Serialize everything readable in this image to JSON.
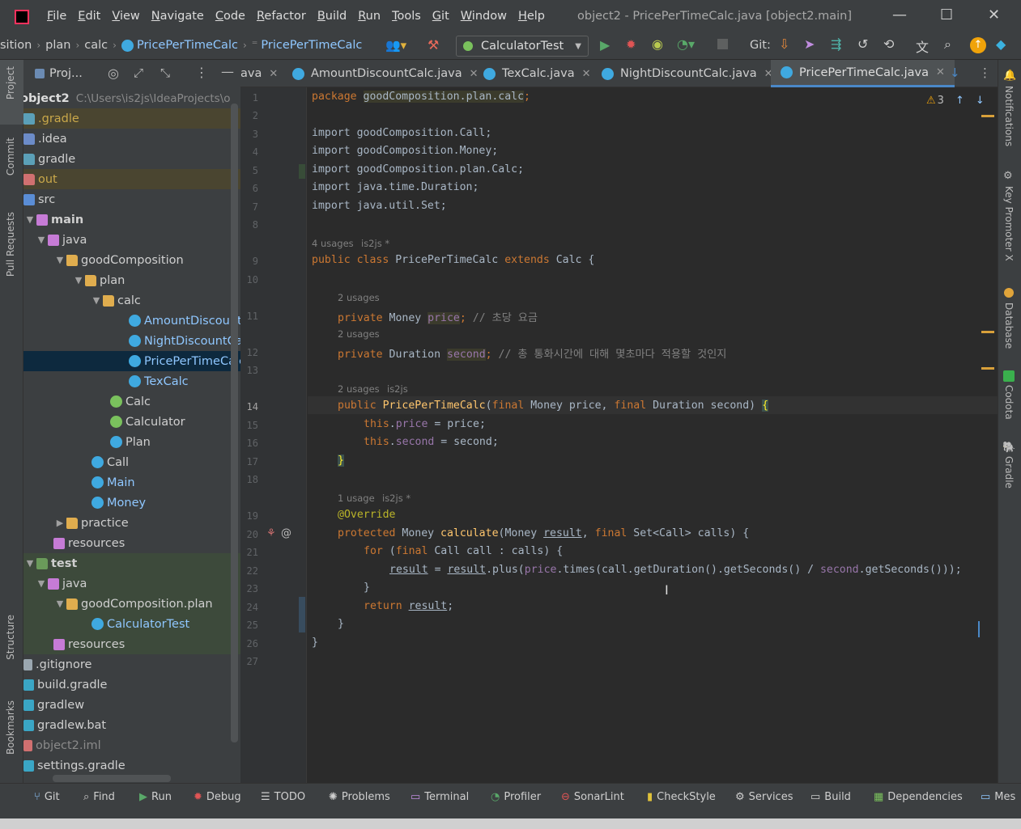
{
  "window": {
    "title": "object2 - PricePerTimeCalc.java [object2.main]",
    "menu": [
      "File",
      "Edit",
      "View",
      "Navigate",
      "Code",
      "Refactor",
      "Build",
      "Run",
      "Tools",
      "Git",
      "Window",
      "Help"
    ]
  },
  "nav": {
    "crumbs": [
      "sition",
      "plan",
      "calc",
      "PricePerTimeCalc",
      "PricePerTimeCalc"
    ],
    "run_config": "CalculatorTest",
    "git_label": "Git:"
  },
  "left_tools": [
    "Project",
    "Commit",
    "Pull Requests",
    "Structure",
    "Bookmarks"
  ],
  "right_tools": [
    "Notifications",
    "Key Promoter X",
    "Database",
    "Codota",
    "Gradle"
  ],
  "project": {
    "header": "Proj...",
    "root_name": "object2",
    "root_path": "C:\\Users\\is2js\\IdeaProjects\\o",
    "rows": [
      {
        "label": ".gradle"
      },
      {
        "label": ".idea"
      },
      {
        "label": "gradle"
      },
      {
        "label": "out"
      },
      {
        "label": "src"
      },
      {
        "label": "main"
      },
      {
        "label": "java"
      },
      {
        "label": "goodComposition"
      },
      {
        "label": "plan"
      },
      {
        "label": "calc"
      },
      {
        "label": "AmountDiscount"
      },
      {
        "label": "NightDiscountCa"
      },
      {
        "label": "PricePerTimeCalc"
      },
      {
        "label": "TexCalc"
      },
      {
        "label": "Calc"
      },
      {
        "label": "Calculator"
      },
      {
        "label": "Plan"
      },
      {
        "label": "Call"
      },
      {
        "label": "Main"
      },
      {
        "label": "Money"
      },
      {
        "label": "practice"
      },
      {
        "label": "resources"
      },
      {
        "label": "test"
      },
      {
        "label": "java"
      },
      {
        "label": "goodComposition.plan"
      },
      {
        "label": "CalculatorTest"
      },
      {
        "label": "resources"
      },
      {
        "label": ".gitignore"
      },
      {
        "label": "build.gradle"
      },
      {
        "label": "gradlew"
      },
      {
        "label": "gradlew.bat"
      },
      {
        "label": "object2.iml"
      },
      {
        "label": "settings.gradle"
      }
    ]
  },
  "tabs": [
    {
      "label": "ava"
    },
    {
      "label": "AmountDiscountCalc.java"
    },
    {
      "label": "TexCalc.java"
    },
    {
      "label": "NightDiscountCalc.java"
    },
    {
      "label": "PricePerTimeCalc.java"
    }
  ],
  "editor": {
    "warning_count": "3",
    "line_numbers": [
      "1",
      "2",
      "3",
      "4",
      "5",
      "6",
      "7",
      "8",
      "9",
      "10",
      "11",
      "12",
      "13",
      "14",
      "15",
      "16",
      "17",
      "18",
      "19",
      "20",
      "21",
      "22",
      "23",
      "24",
      "25",
      "26",
      "27"
    ],
    "hints": {
      "h9": "4 usages",
      "h9a": "is2js *",
      "h11": "2 usages",
      "h12": "2 usages",
      "h14": "2 usages",
      "h14a": "is2js",
      "h20": "1 usage",
      "h20a": "is2js *"
    },
    "code": {
      "l1a": "package ",
      "l1b": "goodComposition.plan.calc",
      "l1c": ";",
      "l3": "import goodComposition.Call;",
      "l4": "import goodComposition.Money;",
      "l5": "import goodComposition.plan.Calc;",
      "l6": "import java.time.Duration;",
      "l7": "import java.util.Set;",
      "l9a": "public class ",
      "l9b": "PricePerTimeCalc ",
      "l9c": "extends ",
      "l9d": "Calc {",
      "l11a": "private ",
      "l11b": "Money ",
      "l11c": "price",
      "l11d": "; ",
      "l11e": "// 초당 요금",
      "l12a": "private ",
      "l12b": "Duration ",
      "l12c": "second",
      "l12d": "; ",
      "l12e": "// 총 통화시간에 대해 몇초마다 적용할 것인지",
      "l14a": "public ",
      "l14b": "PricePerTimeCalc",
      "l14c": "(",
      "l14d": "final ",
      "l14e": "Money price, ",
      "l14f": "final ",
      "l14g": "Duration second) ",
      "l14h": "{",
      "l15a": "this",
      "l15b": ".",
      "l15c": "price",
      "l15d": " = price;",
      "l16a": "this",
      "l16b": ".",
      "l16c": "second",
      "l16d": " = second;",
      "l17": "}",
      "l19": "@Override",
      "l20a": "protected ",
      "l20b": "Money ",
      "l20c": "calculate",
      "l20d": "(Money ",
      "l20e": "result",
      "l20f": ", ",
      "l20g": "final ",
      "l20h": "Set<Call> calls) {",
      "l21a": "for ",
      "l21b": "(",
      "l21c": "final ",
      "l21d": "Call call : calls) {",
      "l22a": "result",
      "l22b": " = ",
      "l22c": "result",
      "l22d": ".plus(",
      "l22e": "price",
      "l22f": ".times(call.getDuration().getSeconds() / ",
      "l22g": "second",
      "l22h": ".getSeconds()));",
      "l23": "}",
      "l24a": "return ",
      "l24b": "result",
      "l24c": ";",
      "l25": "}",
      "l26": "}"
    }
  },
  "bottom_tools": [
    "Git",
    "Find",
    "Run",
    "Debug",
    "TODO",
    "Problems",
    "Terminal",
    "Profiler",
    "SonarLint",
    "CheckStyle",
    "Services",
    "Build",
    "Dependencies",
    "Mes"
  ],
  "colors": {
    "accent": "#4a88c7",
    "keyword": "#cc7832",
    "field": "#9876aa",
    "method": "#ffc66d"
  }
}
